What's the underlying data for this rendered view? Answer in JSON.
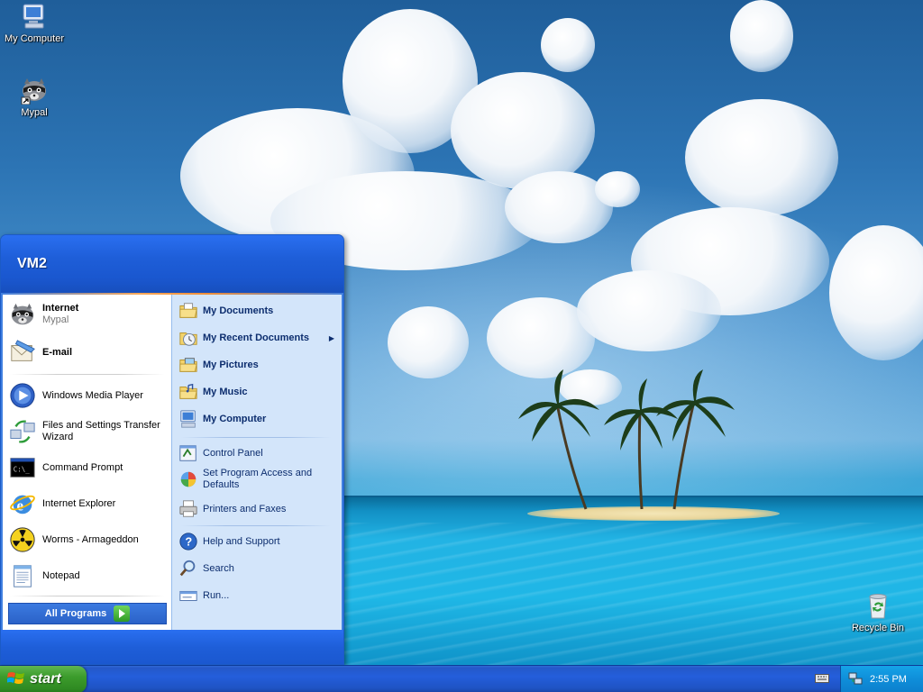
{
  "desktop": {
    "icons": [
      {
        "label": "My Computer",
        "icon": "my-computer-icon"
      },
      {
        "label": "Mypal",
        "icon": "mypal-raccoon-icon"
      },
      {
        "label": "Recycle Bin",
        "icon": "recycle-bin-icon"
      }
    ]
  },
  "start_menu": {
    "user": "VM2",
    "pinned": [
      {
        "title": "Internet",
        "subtitle": "Mypal",
        "icon": "mypal-raccoon-icon"
      },
      {
        "title": "E-mail",
        "icon": "email-icon"
      }
    ],
    "recent": [
      {
        "label": "Windows Media Player",
        "icon": "windows-media-player-icon"
      },
      {
        "label": "Files and Settings Transfer Wizard",
        "icon": "transfer-wizard-icon"
      },
      {
        "label": "Command Prompt",
        "icon": "command-prompt-icon"
      },
      {
        "label": "Internet Explorer",
        "icon": "internet-explorer-icon"
      },
      {
        "label": "Worms - Armageddon",
        "icon": "worms-radiation-icon"
      },
      {
        "label": "Notepad",
        "icon": "notepad-icon"
      }
    ],
    "all_programs": "All Programs",
    "places": [
      {
        "label": "My Documents",
        "icon": "folder-documents-icon"
      },
      {
        "label": "My Recent Documents",
        "icon": "recent-documents-icon",
        "submenu": true
      },
      {
        "label": "My Pictures",
        "icon": "folder-pictures-icon"
      },
      {
        "label": "My Music",
        "icon": "folder-music-icon"
      },
      {
        "label": "My Computer",
        "icon": "my-computer-icon"
      }
    ],
    "settings": [
      {
        "label": "Control Panel",
        "icon": "control-panel-icon"
      },
      {
        "label": "Set Program Access and Defaults",
        "icon": "program-access-icon"
      },
      {
        "label": "Printers and Faxes",
        "icon": "printer-icon"
      }
    ],
    "tools": [
      {
        "label": "Help and Support",
        "icon": "help-icon"
      },
      {
        "label": "Search",
        "icon": "search-icon"
      },
      {
        "label": "Run...",
        "icon": "run-icon"
      }
    ]
  },
  "taskbar": {
    "start_label": "start",
    "clock": "2:55 PM"
  }
}
